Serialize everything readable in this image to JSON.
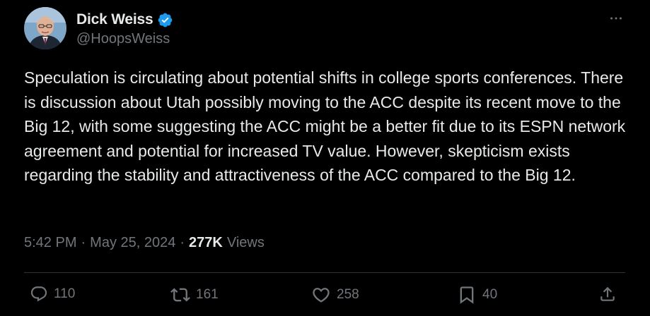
{
  "author": {
    "display_name": "Dick Weiss",
    "handle": "@HoopsWeiss",
    "verified": true
  },
  "tweet": {
    "text": "Speculation is circulating about potential shifts in college sports conferences. There is discussion about Utah possibly moving to the ACC despite its recent move to the Big 12, with some suggesting the ACC might be a better fit due to its ESPN network agreement and potential for increased TV value. However, skepticism exists regarding the stability and attractiveness of the ACC compared to the Big 12.",
    "time": "5:42 PM",
    "separator": "·",
    "date": "May 25, 2024",
    "views_count": "277K",
    "views_label": "Views"
  },
  "actions": {
    "reply_count": "110",
    "repost_count": "161",
    "like_count": "258",
    "bookmark_count": "40"
  },
  "colors": {
    "background": "#000000",
    "text": "#e7e9ea",
    "muted": "#71767b",
    "verified": "#1d9bf0",
    "divider": "#2f3336"
  },
  "icons": [
    "more-icon",
    "verified-badge-icon",
    "reply-icon",
    "repost-icon",
    "like-icon",
    "bookmark-icon",
    "share-icon"
  ]
}
